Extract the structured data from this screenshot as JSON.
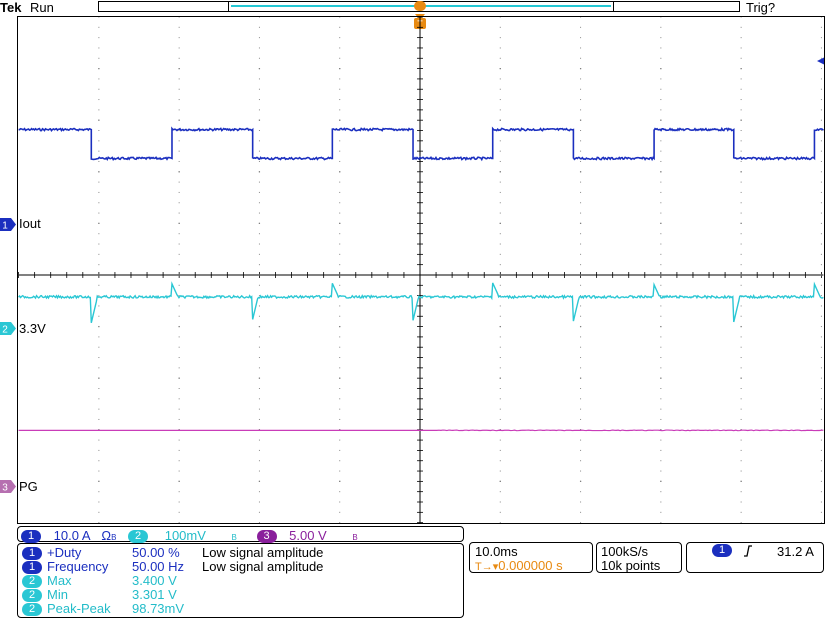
{
  "header": {
    "brand": "Tek",
    "status": "Run",
    "trig_status": "Trig?"
  },
  "trigger_marker": "T",
  "channels": [
    {
      "num": "1",
      "label": "Iout",
      "color": "#1b2fbf"
    },
    {
      "num": "2",
      "label": "3.3V",
      "color": "#2ac7d4"
    },
    {
      "num": "3",
      "label": "PG",
      "color": "#c93cb8"
    }
  ],
  "scales": {
    "ch1": {
      "num": "1",
      "value": "10.0 A",
      "suffix": "Ω"
    },
    "ch2": {
      "num": "2",
      "value": "100mV"
    },
    "ch3": {
      "num": "3",
      "value": "5.00 V"
    },
    "bw_mark": "B"
  },
  "measurements": [
    {
      "num": "1",
      "name": "+Duty",
      "value": "50.00 %",
      "note": "Low signal amplitude",
      "channel": 1
    },
    {
      "num": "1",
      "name": "Frequency",
      "value": "50.00 Hz",
      "note": "Low signal amplitude",
      "channel": 1
    },
    {
      "num": "2",
      "name": "Max",
      "value": "3.400 V",
      "note": "",
      "channel": 2
    },
    {
      "num": "2",
      "name": "Min",
      "value": "3.301 V",
      "note": "",
      "channel": 2
    },
    {
      "num": "2",
      "name": "Peak-Peak",
      "value": "98.73mV",
      "note": "",
      "channel": 2
    }
  ],
  "timebase": {
    "scale": "10.0ms",
    "position_icon": "T→▾",
    "position": "0.000000 s"
  },
  "acquisition": {
    "rate": "100kS/s",
    "length": "10k points"
  },
  "trigger": {
    "source": "1",
    "slope_icon": "rising-edge-icon",
    "level": "31.2 A"
  },
  "waveforms": {
    "ch1": {
      "period_ms": 20,
      "duty": 0.5,
      "color": "#1b2fbf"
    },
    "ch2": {
      "color": "#2ac7d4"
    },
    "ch3": {
      "color": "#c93cb8"
    }
  }
}
